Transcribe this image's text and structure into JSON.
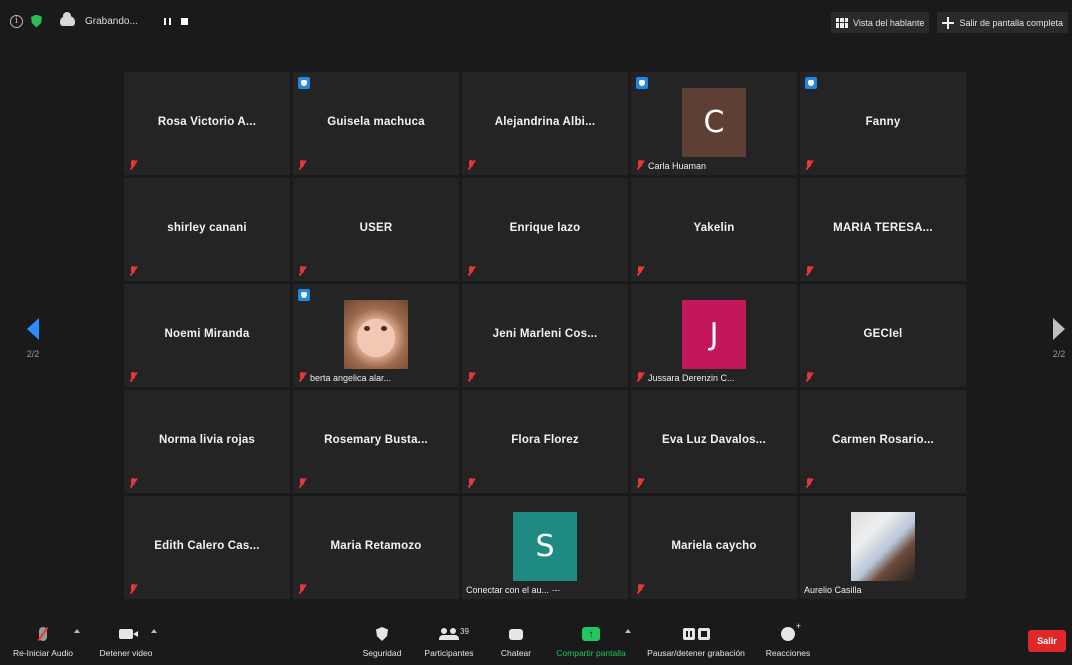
{
  "topbar": {
    "info_icon_glyph": "i",
    "recording_label": "Grabando...",
    "speaker_view_label": "Vista del hablante",
    "exit_fullscreen_label": "Salir de pantalla completa"
  },
  "grid": {
    "tiles": [
      {
        "name": "Rosa Victorio  A...",
        "hand": false,
        "avatar": null,
        "tag": null
      },
      {
        "name": "Guisela machuca",
        "hand": true,
        "avatar": null,
        "tag": null
      },
      {
        "name": "Alejandrina  Albi...",
        "hand": false,
        "avatar": null,
        "tag": null
      },
      {
        "name": "",
        "hand": true,
        "avatar": {
          "letter": "C",
          "color": "#5e3f33"
        },
        "tag": "Carla Huaman"
      },
      {
        "name": "Fanny",
        "hand": true,
        "avatar": null,
        "tag": null
      },
      {
        "name": "shirley canani",
        "hand": false,
        "avatar": null,
        "tag": null
      },
      {
        "name": "USER",
        "hand": false,
        "avatar": null,
        "tag": null
      },
      {
        "name": "Enrique lazo",
        "hand": false,
        "avatar": null,
        "tag": null
      },
      {
        "name": "Yakelin",
        "hand": false,
        "avatar": null,
        "tag": null
      },
      {
        "name": "MARIA  TERESA...",
        "hand": false,
        "avatar": null,
        "tag": null
      },
      {
        "name": "Noemi Miranda",
        "hand": false,
        "avatar": null,
        "tag": null
      },
      {
        "name": "",
        "hand": true,
        "avatar": {
          "photo": "child"
        },
        "tag": "berta angelica alar..."
      },
      {
        "name": "Jeni  Marleni  Cos...",
        "hand": false,
        "avatar": null,
        "tag": null
      },
      {
        "name": "",
        "hand": false,
        "avatar": {
          "letter": "J",
          "color": "#c2185b"
        },
        "tag": "Jussara Derenzin C..."
      },
      {
        "name": "GECIel",
        "hand": false,
        "avatar": null,
        "tag": null
      },
      {
        "name": "Norma livia rojas",
        "hand": false,
        "avatar": null,
        "tag": null
      },
      {
        "name": "Rosemary  Busta...",
        "hand": false,
        "avatar": null,
        "tag": null
      },
      {
        "name": "Flora Florez",
        "hand": false,
        "avatar": null,
        "tag": null
      },
      {
        "name": "Eva Luz  Davalos...",
        "hand": false,
        "avatar": null,
        "tag": null
      },
      {
        "name": "Carmen  Rosario...",
        "hand": false,
        "avatar": null,
        "tag": null
      },
      {
        "name": "Edith  Calero  Cas...",
        "hand": false,
        "avatar": null,
        "tag": null
      },
      {
        "name": "Maria Retamozo",
        "hand": false,
        "avatar": null,
        "tag": null
      },
      {
        "name": "",
        "hand": false,
        "avatar": {
          "letter": "S",
          "color": "#1f8a82"
        },
        "tag": "Conectar con el au...  ·-·",
        "tag_nomic": true
      },
      {
        "name": "Mariela caycho",
        "hand": false,
        "avatar": null,
        "tag": null
      },
      {
        "name": "",
        "hand": false,
        "avatar": {
          "photo": "art"
        },
        "tag": "Aurelio Casilla",
        "tag_nomic": true
      }
    ]
  },
  "nav": {
    "left_page": "2/2",
    "right_page": "2/2"
  },
  "toolbar": {
    "audio_label": "Re-Iniciar Audio",
    "video_label": "Detener video",
    "security_label": "Seguridad",
    "participants_label": "Participantes",
    "participants_count": "39",
    "chat_label": "Chatear",
    "share_label": "Compartir pantalla",
    "share_glyph": "↑",
    "record_label": "Pausar/detener grabación",
    "reactions_label": "Reacciones",
    "leave_label": "Salir"
  },
  "colors": {
    "raised_hand": "#1e88e5",
    "muted": "#e83737",
    "share_green": "#22c55e",
    "leave_red": "#e02828",
    "nav_arrow_blue": "#2d8cff"
  }
}
